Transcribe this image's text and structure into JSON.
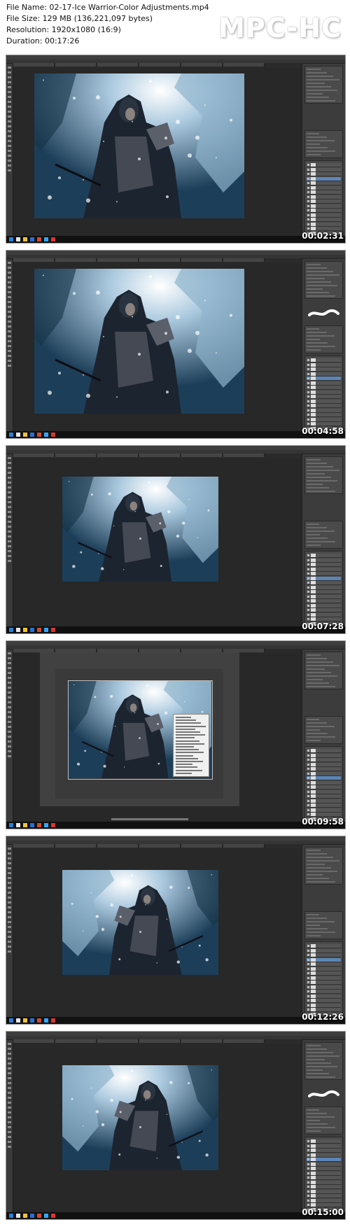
{
  "header": {
    "file_name": "File Name: 02-17-Ice Warrior-Color Adjustments.mp4",
    "file_size": "File Size: 129 MB (136,221,097 bytes)",
    "resolution": "Resolution: 1920x1080 (16:9)",
    "duration": "Duration: 00:17:26",
    "logo": "MPC-HC"
  },
  "thumbnails": [
    {
      "timestamp": "00:02:31"
    },
    {
      "timestamp": "00:04:58"
    },
    {
      "timestamp": "00:07:28"
    },
    {
      "timestamp": "00:09:58"
    },
    {
      "timestamp": "00:12:26"
    },
    {
      "timestamp": "00:15:00"
    }
  ],
  "colors": {
    "ps_dark": "#2c2c2c",
    "panel": "#3c3c3c",
    "selected_layer": "#5b85b5",
    "ice_blue": "#6f9cc0",
    "snow_white": "#e6f0f6"
  },
  "icons": [
    "photoshop-icon",
    "chrome-icon",
    "folder-icon",
    "windows-start-icon"
  ]
}
